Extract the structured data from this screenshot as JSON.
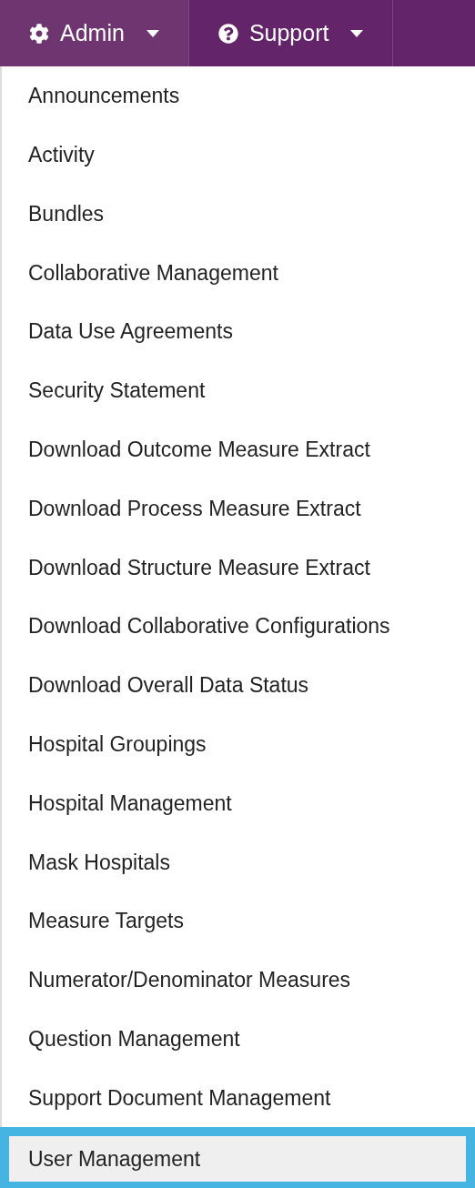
{
  "nav": [
    {
      "label": "Admin",
      "selected": true
    },
    {
      "label": "Support",
      "selected": false
    }
  ],
  "menu": [
    {
      "label": "Announcements",
      "selected": false
    },
    {
      "label": "Activity",
      "selected": false
    },
    {
      "label": "Bundles",
      "selected": false
    },
    {
      "label": "Collaborative Management",
      "selected": false
    },
    {
      "label": "Data Use Agreements",
      "selected": false
    },
    {
      "label": "Security Statement",
      "selected": false
    },
    {
      "label": "Download Outcome Measure Extract",
      "selected": false
    },
    {
      "label": "Download Process Measure Extract",
      "selected": false
    },
    {
      "label": "Download Structure Measure Extract",
      "selected": false
    },
    {
      "label": "Download Collaborative Configurations",
      "selected": false
    },
    {
      "label": "Download Overall Data Status",
      "selected": false
    },
    {
      "label": "Hospital Groupings",
      "selected": false
    },
    {
      "label": "Hospital Management",
      "selected": false
    },
    {
      "label": "Mask Hospitals",
      "selected": false
    },
    {
      "label": "Measure Targets",
      "selected": false
    },
    {
      "label": "Numerator/Denominator Measures",
      "selected": false
    },
    {
      "label": "Question Management",
      "selected": false
    },
    {
      "label": "Support Document Management",
      "selected": false
    },
    {
      "label": "User Management",
      "selected": true
    }
  ]
}
